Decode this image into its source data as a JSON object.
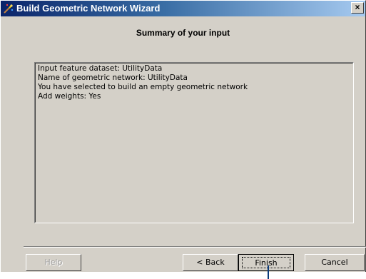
{
  "window": {
    "title": "Build Geometric Network Wizard",
    "close_glyph": "×"
  },
  "heading": "Summary of your input",
  "summary_lines": [
    "Input feature dataset: UtilityData",
    "Name of geometric network: UtilityData",
    "You have selected to build an empty geometric network",
    "Add weights: Yes"
  ],
  "buttons": {
    "help": "Help",
    "back": "< Back",
    "finish": "Finish",
    "cancel": "Cancel"
  },
  "icons": {
    "title_icon": "network-wizard-icon",
    "close": "close-icon"
  },
  "colors": {
    "titlebar_start": "#0a246a",
    "titlebar_end": "#a6caf0",
    "dialog_face": "#d4d0c8",
    "callout_line": "#0a3a7a"
  }
}
